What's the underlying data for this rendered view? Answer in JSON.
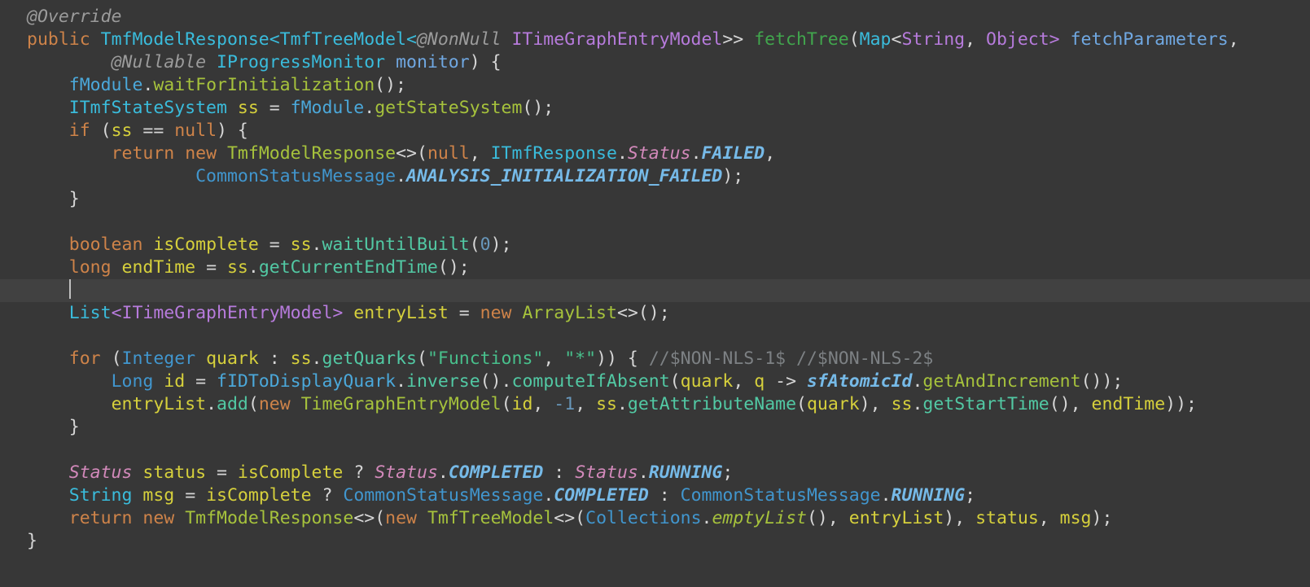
{
  "editor": {
    "language": "java",
    "background": "#373737",
    "current_line_background": "#414141",
    "cursor_color": "#c0c0c0",
    "default_text_color": "#d6d6d6",
    "palette": {
      "kw": {
        "color": "#ce8349",
        "desc": "keyword"
      },
      "ann": {
        "color": "#9b9b9b",
        "italic": true,
        "desc": "annotation"
      },
      "typ": {
        "color": "#3abcdc",
        "desc": "interface-or-type"
      },
      "cls": {
        "color": "#4196ce",
        "desc": "class-type"
      },
      "fld": {
        "color": "#4ba8da",
        "desc": "field"
      },
      "decl": {
        "color": "#41a64d",
        "desc": "method-declaration"
      },
      "meth": {
        "color": "#a6c23c",
        "desc": "method-invocation"
      },
      "methi": {
        "color": "#a6c23c",
        "italic": true,
        "desc": "static-method-invocation"
      },
      "imeth": {
        "color": "#52c9a4",
        "desc": "abstract-method-invocation"
      },
      "str": {
        "color": "#48c08c",
        "desc": "string-literal"
      },
      "var": {
        "color": "#d6d03c",
        "desc": "local-variable"
      },
      "par": {
        "color": "#70a8e2",
        "desc": "parameter"
      },
      "gen": {
        "color": "#b77bdc",
        "desc": "type-argument"
      },
      "enum": {
        "color": "#d289ba",
        "italic": true,
        "desc": "enum-type"
      },
      "const": {
        "color": "#76bae8",
        "bold": true,
        "italic": true,
        "desc": "static-final-constant"
      },
      "num": {
        "color": "#6897bb",
        "desc": "number-literal"
      },
      "pun": {
        "color": "#d6d6d6",
        "desc": "punctuation-default"
      },
      "com": {
        "color": "#7d8184",
        "desc": "comment"
      }
    },
    "lines": [
      {
        "tokens": [
          [
            "ann",
            "@Override"
          ]
        ]
      },
      {
        "tokens": [
          [
            "kw",
            "public"
          ],
          [
            "pun",
            " "
          ],
          [
            "typ",
            "TmfModelResponse<TmfTreeModel<"
          ],
          [
            "ann",
            "@NonNull"
          ],
          [
            "pun",
            " "
          ],
          [
            "gen",
            "ITimeGraphEntryModel"
          ],
          [
            "pun",
            ">> "
          ],
          [
            "decl",
            "fetchTree"
          ],
          [
            "pun",
            "("
          ],
          [
            "typ",
            "Map"
          ],
          [
            "pun",
            "<"
          ],
          [
            "gen",
            "String"
          ],
          [
            "pun",
            ", "
          ],
          [
            "gen",
            "Object>"
          ],
          [
            "pun",
            " "
          ],
          [
            "par",
            "fetchParameters"
          ],
          [
            "pun",
            ","
          ]
        ]
      },
      {
        "tokens": [
          [
            "pun",
            "        "
          ],
          [
            "ann",
            "@Nullable"
          ],
          [
            "pun",
            " "
          ],
          [
            "typ",
            "IProgressMonitor"
          ],
          [
            "pun",
            " "
          ],
          [
            "par",
            "monitor"
          ],
          [
            "pun",
            ") {"
          ]
        ]
      },
      {
        "tokens": [
          [
            "pun",
            "    "
          ],
          [
            "fld",
            "fModule"
          ],
          [
            "pun",
            "."
          ],
          [
            "meth",
            "waitForInitialization"
          ],
          [
            "pun",
            "();"
          ]
        ]
      },
      {
        "tokens": [
          [
            "pun",
            "    "
          ],
          [
            "typ",
            "ITmfStateSystem"
          ],
          [
            "pun",
            " "
          ],
          [
            "var",
            "ss"
          ],
          [
            "pun",
            " = "
          ],
          [
            "fld",
            "fModule"
          ],
          [
            "pun",
            "."
          ],
          [
            "meth",
            "getStateSystem"
          ],
          [
            "pun",
            "();"
          ]
        ]
      },
      {
        "tokens": [
          [
            "pun",
            "    "
          ],
          [
            "kw",
            "if"
          ],
          [
            "pun",
            " ("
          ],
          [
            "var",
            "ss"
          ],
          [
            "pun",
            " == "
          ],
          [
            "kw",
            "null"
          ],
          [
            "pun",
            ") {"
          ]
        ]
      },
      {
        "tokens": [
          [
            "pun",
            "        "
          ],
          [
            "kw",
            "return"
          ],
          [
            "pun",
            " "
          ],
          [
            "kw",
            "new"
          ],
          [
            "pun",
            " "
          ],
          [
            "meth",
            "TmfModelResponse"
          ],
          [
            "pun",
            "<>("
          ],
          [
            "kw",
            "null"
          ],
          [
            "pun",
            ", "
          ],
          [
            "typ",
            "ITmfResponse"
          ],
          [
            "pun",
            "."
          ],
          [
            "enum",
            "Status"
          ],
          [
            "pun",
            "."
          ],
          [
            "const",
            "FAILED"
          ],
          [
            "pun",
            ","
          ]
        ]
      },
      {
        "tokens": [
          [
            "pun",
            "                "
          ],
          [
            "cls",
            "CommonStatusMessage"
          ],
          [
            "pun",
            "."
          ],
          [
            "const",
            "ANALYSIS_INITIALIZATION_FAILED"
          ],
          [
            "pun",
            ");"
          ]
        ]
      },
      {
        "tokens": [
          [
            "pun",
            "    }"
          ]
        ]
      },
      {
        "tokens": []
      },
      {
        "tokens": [
          [
            "pun",
            "    "
          ],
          [
            "kw",
            "boolean"
          ],
          [
            "pun",
            " "
          ],
          [
            "var",
            "isComplete"
          ],
          [
            "pun",
            " = "
          ],
          [
            "var",
            "ss"
          ],
          [
            "pun",
            "."
          ],
          [
            "imeth",
            "waitUntilBuilt"
          ],
          [
            "pun",
            "("
          ],
          [
            "num",
            "0"
          ],
          [
            "pun",
            ");"
          ]
        ]
      },
      {
        "tokens": [
          [
            "pun",
            "    "
          ],
          [
            "kw",
            "long"
          ],
          [
            "pun",
            " "
          ],
          [
            "var",
            "endTime"
          ],
          [
            "pun",
            " = "
          ],
          [
            "var",
            "ss"
          ],
          [
            "pun",
            "."
          ],
          [
            "imeth",
            "getCurrentEndTime"
          ],
          [
            "pun",
            "();"
          ]
        ]
      },
      {
        "current": true,
        "cursor": true,
        "tokens": [
          [
            "pun",
            "    "
          ]
        ]
      },
      {
        "tokens": [
          [
            "pun",
            "    "
          ],
          [
            "typ",
            "List"
          ],
          [
            "gen",
            "<ITimeGraphEntryModel>"
          ],
          [
            "pun",
            " "
          ],
          [
            "var",
            "entryList"
          ],
          [
            "pun",
            " = "
          ],
          [
            "kw",
            "new"
          ],
          [
            "pun",
            " "
          ],
          [
            "meth",
            "ArrayList"
          ],
          [
            "pun",
            "<>();"
          ]
        ]
      },
      {
        "tokens": []
      },
      {
        "tokens": [
          [
            "pun",
            "    "
          ],
          [
            "kw",
            "for"
          ],
          [
            "pun",
            " ("
          ],
          [
            "cls",
            "Integer"
          ],
          [
            "pun",
            " "
          ],
          [
            "var",
            "quark"
          ],
          [
            "pun",
            " : "
          ],
          [
            "var",
            "ss"
          ],
          [
            "pun",
            "."
          ],
          [
            "imeth",
            "getQuarks"
          ],
          [
            "pun",
            "("
          ],
          [
            "str",
            "\"Functions\""
          ],
          [
            "pun",
            ", "
          ],
          [
            "str",
            "\"*\""
          ],
          [
            "pun",
            ")) { "
          ],
          [
            "com",
            "//$NON-NLS-1$ //$NON-NLS-2$"
          ]
        ]
      },
      {
        "tokens": [
          [
            "pun",
            "        "
          ],
          [
            "cls",
            "Long"
          ],
          [
            "pun",
            " "
          ],
          [
            "var",
            "id"
          ],
          [
            "pun",
            " = "
          ],
          [
            "fld",
            "fIDToDisplayQuark"
          ],
          [
            "pun",
            "."
          ],
          [
            "imeth",
            "inverse"
          ],
          [
            "pun",
            "()."
          ],
          [
            "imeth",
            "computeIfAbsent"
          ],
          [
            "pun",
            "("
          ],
          [
            "var",
            "quark"
          ],
          [
            "pun",
            ", "
          ],
          [
            "var",
            "q"
          ],
          [
            "pun",
            " -> "
          ],
          [
            "const",
            "sfAtomicId"
          ],
          [
            "pun",
            "."
          ],
          [
            "meth",
            "getAndIncrement"
          ],
          [
            "pun",
            "());"
          ]
        ]
      },
      {
        "tokens": [
          [
            "pun",
            "        "
          ],
          [
            "var",
            "entryList"
          ],
          [
            "pun",
            "."
          ],
          [
            "imeth",
            "add"
          ],
          [
            "pun",
            "("
          ],
          [
            "kw",
            "new"
          ],
          [
            "pun",
            " "
          ],
          [
            "meth",
            "TimeGraphEntryModel"
          ],
          [
            "pun",
            "("
          ],
          [
            "var",
            "id"
          ],
          [
            "pun",
            ", "
          ],
          [
            "num",
            "-1"
          ],
          [
            "pun",
            ", "
          ],
          [
            "var",
            "ss"
          ],
          [
            "pun",
            "."
          ],
          [
            "imeth",
            "getAttributeName"
          ],
          [
            "pun",
            "("
          ],
          [
            "var",
            "quark"
          ],
          [
            "pun",
            "), "
          ],
          [
            "var",
            "ss"
          ],
          [
            "pun",
            "."
          ],
          [
            "imeth",
            "getStartTime"
          ],
          [
            "pun",
            "(), "
          ],
          [
            "var",
            "endTime"
          ],
          [
            "pun",
            "));"
          ]
        ]
      },
      {
        "tokens": [
          [
            "pun",
            "    }"
          ]
        ]
      },
      {
        "tokens": []
      },
      {
        "tokens": [
          [
            "pun",
            "    "
          ],
          [
            "enum",
            "Status"
          ],
          [
            "pun",
            " "
          ],
          [
            "var",
            "status"
          ],
          [
            "pun",
            " = "
          ],
          [
            "var",
            "isComplete"
          ],
          [
            "pun",
            " ? "
          ],
          [
            "enum",
            "Status"
          ],
          [
            "pun",
            "."
          ],
          [
            "const",
            "COMPLETED"
          ],
          [
            "pun",
            " : "
          ],
          [
            "enum",
            "Status"
          ],
          [
            "pun",
            "."
          ],
          [
            "const",
            "RUNNING"
          ],
          [
            "pun",
            ";"
          ]
        ]
      },
      {
        "tokens": [
          [
            "pun",
            "    "
          ],
          [
            "typ",
            "String"
          ],
          [
            "pun",
            " "
          ],
          [
            "var",
            "msg"
          ],
          [
            "pun",
            " = "
          ],
          [
            "var",
            "isComplete"
          ],
          [
            "pun",
            " ? "
          ],
          [
            "cls",
            "CommonStatusMessage"
          ],
          [
            "pun",
            "."
          ],
          [
            "const",
            "COMPLETED"
          ],
          [
            "pun",
            " : "
          ],
          [
            "cls",
            "CommonStatusMessage"
          ],
          [
            "pun",
            "."
          ],
          [
            "const",
            "RUNNING"
          ],
          [
            "pun",
            ";"
          ]
        ]
      },
      {
        "tokens": [
          [
            "pun",
            "    "
          ],
          [
            "kw",
            "return"
          ],
          [
            "pun",
            " "
          ],
          [
            "kw",
            "new"
          ],
          [
            "pun",
            " "
          ],
          [
            "meth",
            "TmfModelResponse"
          ],
          [
            "pun",
            "<>("
          ],
          [
            "kw",
            "new"
          ],
          [
            "pun",
            " "
          ],
          [
            "meth",
            "TmfTreeModel"
          ],
          [
            "pun",
            "<>("
          ],
          [
            "cls",
            "Collections"
          ],
          [
            "pun",
            "."
          ],
          [
            "methi",
            "emptyList"
          ],
          [
            "pun",
            "(), "
          ],
          [
            "var",
            "entryList"
          ],
          [
            "pun",
            "), "
          ],
          [
            "var",
            "status"
          ],
          [
            "pun",
            ", "
          ],
          [
            "var",
            "msg"
          ],
          [
            "pun",
            ");"
          ]
        ]
      },
      {
        "tokens": [
          [
            "pun",
            "}"
          ]
        ]
      }
    ]
  }
}
